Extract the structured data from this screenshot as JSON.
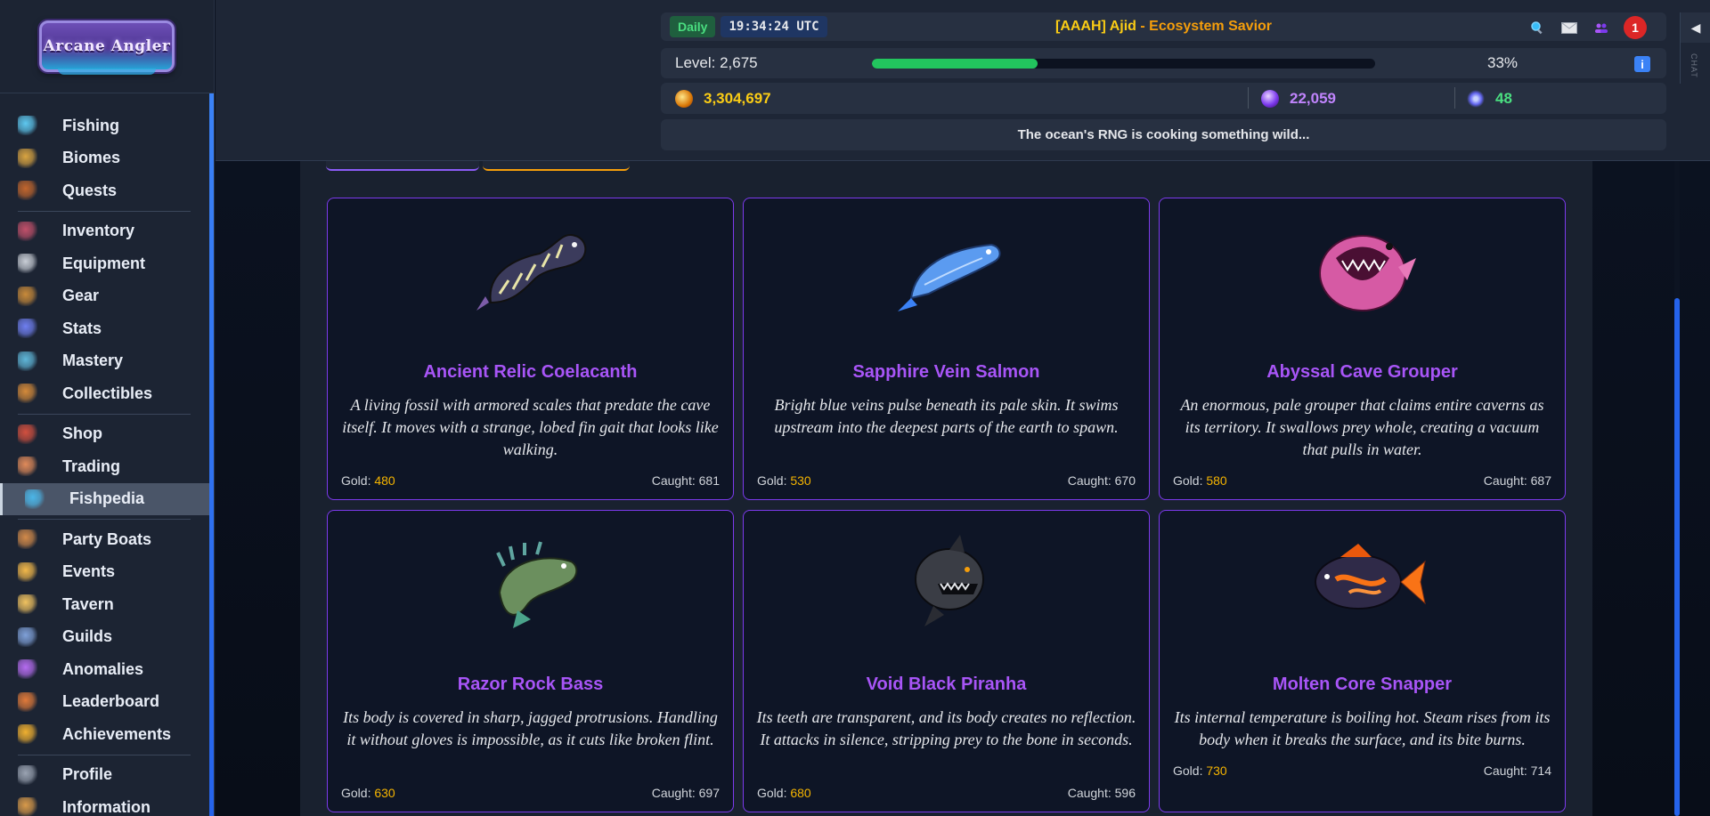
{
  "app": {
    "logo_text": "Arcane Angler",
    "chat_label": "CHAT"
  },
  "sidebar": {
    "items": [
      {
        "label": "Fishing",
        "icon": "fishing-rod-icon",
        "color": "#5ec8f0"
      },
      {
        "label": "Biomes",
        "icon": "map-icon",
        "color": "#d9a441"
      },
      {
        "label": "Quests",
        "icon": "scroll-icon",
        "color": "#c2662d"
      },
      {
        "label": "Inventory",
        "icon": "backpack-icon",
        "color": "#c0506a"
      },
      {
        "label": "Equipment",
        "icon": "crossed-swords-icon",
        "color": "#c9ced6"
      },
      {
        "label": "Gear",
        "icon": "boot-icon",
        "color": "#c88a3a"
      },
      {
        "label": "Stats",
        "icon": "star-burst-icon",
        "color": "#6f7ff0"
      },
      {
        "label": "Mastery",
        "icon": "orb-icon",
        "color": "#5fb6d8"
      },
      {
        "label": "Collectibles",
        "icon": "chest-icon",
        "color": "#d48a3a"
      },
      {
        "label": "Shop",
        "icon": "shop-icon",
        "color": "#d2503f"
      },
      {
        "label": "Trading",
        "icon": "trade-icon",
        "color": "#e08a5a"
      },
      {
        "label": "Fishpedia",
        "icon": "fish-book-icon",
        "color": "#4bb6e8"
      },
      {
        "label": "Party Boats",
        "icon": "boat-icon",
        "color": "#d28a4a"
      },
      {
        "label": "Events",
        "icon": "party-icon",
        "color": "#f2b84a"
      },
      {
        "label": "Tavern",
        "icon": "tavern-icon",
        "color": "#f0c260"
      },
      {
        "label": "Guilds",
        "icon": "guild-icon",
        "color": "#7fa0d8"
      },
      {
        "label": "Anomalies",
        "icon": "crystal-icon",
        "color": "#b56cf0"
      },
      {
        "label": "Leaderboard",
        "icon": "leaderboard-icon",
        "color": "#e07a3a"
      },
      {
        "label": "Achievements",
        "icon": "trophy-icon",
        "color": "#f0b030"
      },
      {
        "label": "Profile",
        "icon": "profile-icon",
        "color": "#9aa3b2"
      },
      {
        "label": "Information",
        "icon": "info-book-icon",
        "color": "#d89a4a"
      }
    ],
    "active": "Fishpedia"
  },
  "header": {
    "daily_label": "Daily",
    "time": "19:34:24 UTC",
    "player_tag": "[AAAH] Ajid",
    "player_sep": " - ",
    "player_title": "Ecosystem Savior",
    "notification_count": "1",
    "level_text": "Level: 2,675",
    "xp_percent_text": "33%",
    "xp_fraction": 0.33,
    "gold": "3,304,697",
    "gems": "22,059",
    "shards": "48",
    "gold_color": "#facc15",
    "gems_color": "#c084fc",
    "shards_color": "#4ade80",
    "message": "The ocean's RNG is cooking something wild..."
  },
  "cards": [
    {
      "name": "Ancient Relic Coelacanth",
      "desc": "A living fossil with armored scales that predate the cave itself. It moves with a strange, lobed fin gait that looks like walking.",
      "gold_label": "Gold: ",
      "gold": "480",
      "caught": "Caught: 681",
      "icon": "coelacanth-icon"
    },
    {
      "name": "Sapphire Vein Salmon",
      "desc": "Bright blue veins pulse beneath its pale skin. It swims upstream into the deepest parts of the earth to spawn.",
      "gold_label": "Gold: ",
      "gold": "530",
      "caught": "Caught: 670",
      "icon": "salmon-icon"
    },
    {
      "name": "Abyssal Cave Grouper",
      "desc": "An enormous, pale grouper that claims entire caverns as its territory. It swallows prey whole, creating a vacuum that pulls in water.",
      "gold_label": "Gold: ",
      "gold": "580",
      "caught": "Caught: 687",
      "icon": "grouper-icon"
    },
    {
      "name": "Razor Rock Bass",
      "desc": "Its body is covered in sharp, jagged protrusions. Handling it without gloves is impossible, as it cuts like broken flint.",
      "gold_label": "Gold: ",
      "gold": "630",
      "caught": "Caught: 697",
      "icon": "bass-icon"
    },
    {
      "name": "Void Black Piranha",
      "desc": "Its teeth are transparent, and its body creates no reflection. It attacks in silence, stripping prey to the bone in seconds.",
      "gold_label": "Gold: ",
      "gold": "680",
      "caught": "Caught: 596",
      "icon": "piranha-icon"
    },
    {
      "name": "Molten Core Snapper",
      "desc": "Its internal temperature is boiling hot. Steam rises from its body when it breaks the surface, and its bite burns.",
      "gold_label": "Gold: ",
      "gold": "730",
      "caught": "Caught: 714",
      "icon": "snapper-icon"
    }
  ]
}
